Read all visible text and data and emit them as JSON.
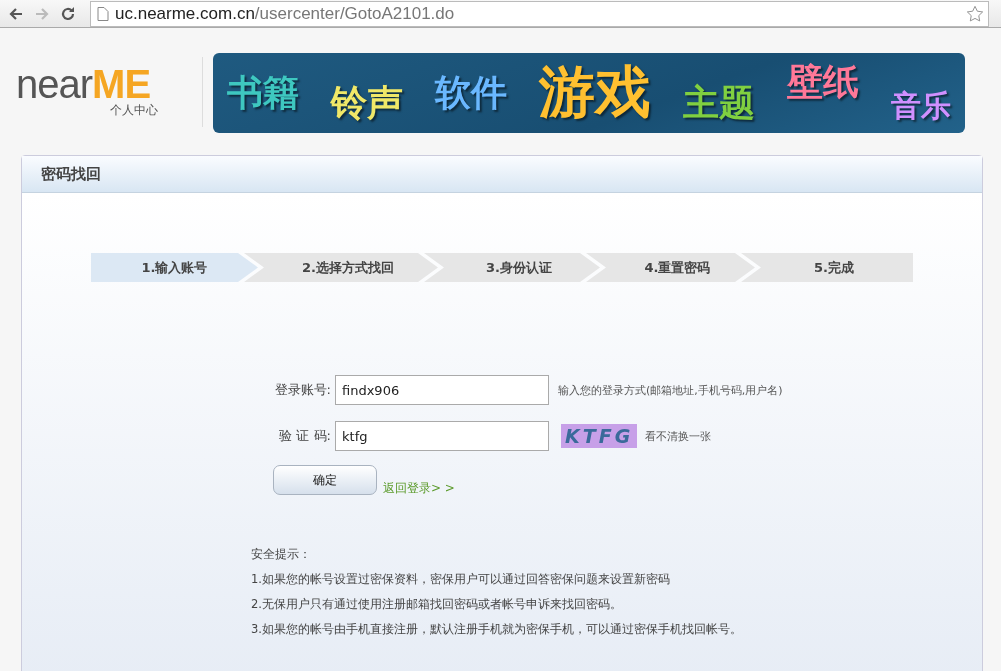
{
  "browser": {
    "url_host": "uc.nearme.com.cn",
    "url_path": "/usercenter/GotoA2101.do"
  },
  "logo": {
    "word": "near",
    "accent": "ME",
    "subtitle": "个人中心"
  },
  "banner": [
    {
      "text": "书籍",
      "color": "#3ec8c0"
    },
    {
      "text": "铃声",
      "color": "#f0e868"
    },
    {
      "text": "软件",
      "color": "#6ab8ff"
    },
    {
      "text": "游戏",
      "color": "#ffc030"
    },
    {
      "text": "主题",
      "color": "#80d040"
    },
    {
      "text": "壁纸",
      "color": "#ff7898"
    },
    {
      "text": "音乐",
      "color": "#d090ff"
    }
  ],
  "panel": {
    "title": "密码找回"
  },
  "steps": [
    {
      "label": "1.输入账号",
      "selected": true
    },
    {
      "label": "2.选择方式找回",
      "selected": false
    },
    {
      "label": "3.身份认证",
      "selected": false
    },
    {
      "label": "4.重置密码",
      "selected": false
    },
    {
      "label": "5.完成",
      "selected": false
    }
  ],
  "form": {
    "account": {
      "label": "登录账号:",
      "value": "findx906",
      "hint": "输入您的登录方式(邮箱地址,手机号码,用户名)"
    },
    "captcha": {
      "label": "验 证 码:",
      "value": "ktfg",
      "image_text": "KTFG",
      "refresh": "看不清换一张"
    },
    "submit": "确定",
    "back_link": "返回登录> >"
  },
  "tips": {
    "title": "安全提示：",
    "items": [
      "1.如果您的帐号设置过密保资料，密保用户可以通过回答密保问题来设置新密码",
      "2.无保用户只有通过使用注册邮箱找回密码或者帐号申诉来找回密码。",
      "3.如果您的帐号由手机直接注册，默认注册手机就为密保手机，可以通过密保手机找回帐号。"
    ]
  }
}
